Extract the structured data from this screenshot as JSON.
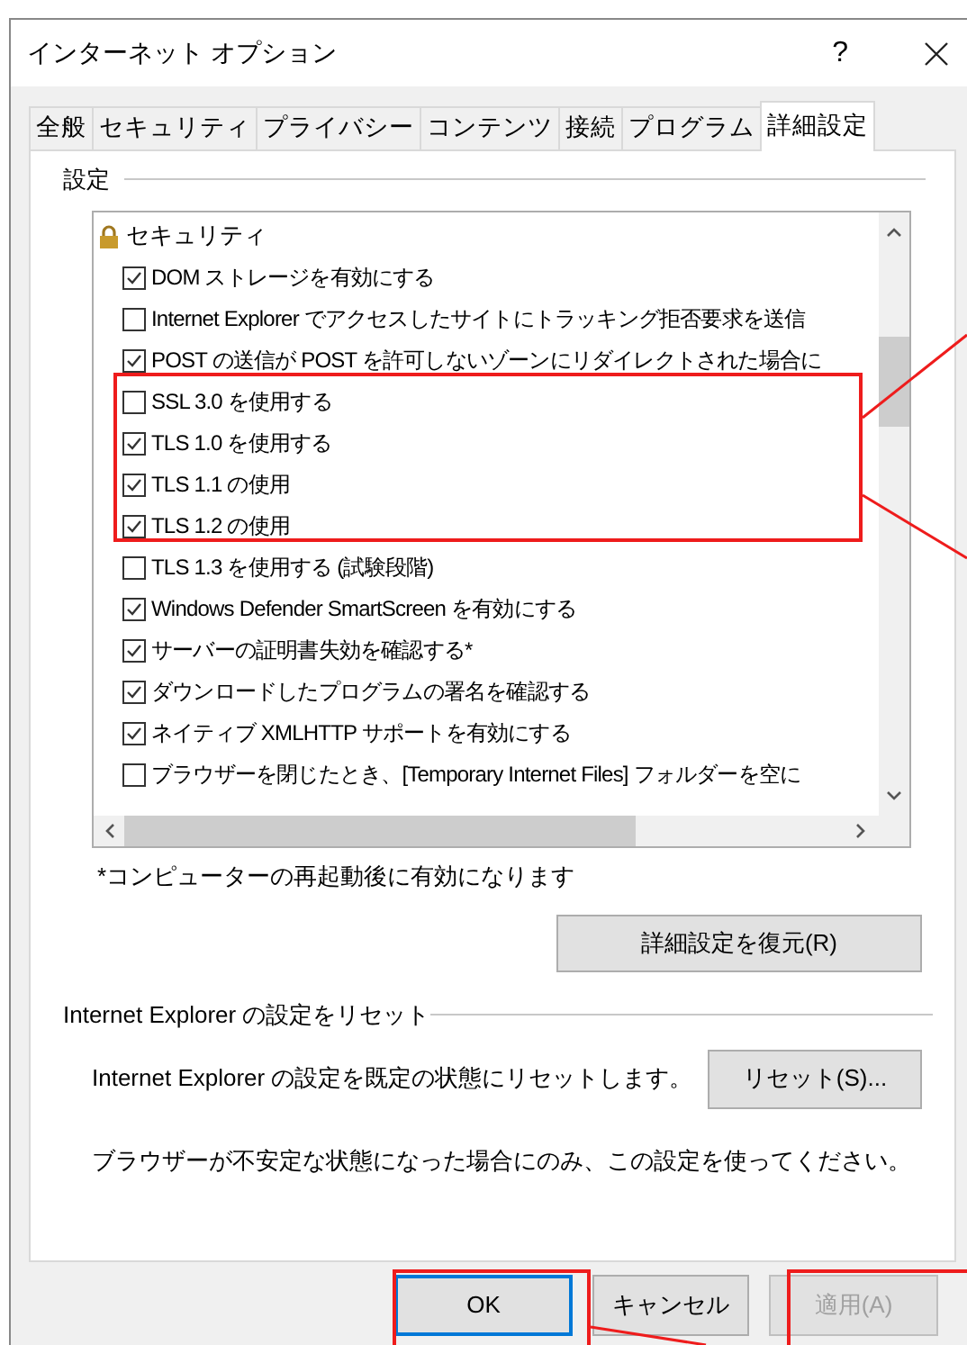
{
  "window": {
    "title": "インターネット オプション",
    "help": "?"
  },
  "tabs": [
    {
      "label": "全般",
      "selected": false
    },
    {
      "label": "セキュリティ",
      "selected": false
    },
    {
      "label": "プライバシー",
      "selected": false
    },
    {
      "label": "コンテンツ",
      "selected": false
    },
    {
      "label": "接続",
      "selected": false
    },
    {
      "label": "プログラム",
      "selected": false
    },
    {
      "label": "詳細設定",
      "selected": true
    }
  ],
  "settings": {
    "title": "設定",
    "categories": [
      {
        "label": "セキュリティ",
        "children": [
          {
            "label": "DOM ストレージを有効にする",
            "checked": true
          },
          {
            "label": "Internet Explorer でアクセスしたサイトにトラッキング拒否要求を送信",
            "checked": false
          },
          {
            "label": "POST の送信が POST を許可しないゾーンにリダイレクトされた場合に",
            "checked": true
          },
          {
            "label": "SSL 3.0 を使用する",
            "checked": false
          },
          {
            "label": "TLS 1.0 を使用する",
            "checked": true
          },
          {
            "label": "TLS 1.1 の使用",
            "checked": true
          },
          {
            "label": "TLS 1.2 の使用",
            "checked": true
          },
          {
            "label": "TLS 1.3 を使用する (試験段階)",
            "checked": false
          },
          {
            "label": "Windows Defender SmartScreen を有効にする",
            "checked": true
          },
          {
            "label": "サーバーの証明書失効を確認する*",
            "checked": true
          },
          {
            "label": "ダウンロードしたプログラムの署名を確認する",
            "checked": true
          },
          {
            "label": "ネイティブ XMLHTTP サポートを有効にする",
            "checked": true
          },
          {
            "label": "ブラウザーを閉じたとき、[Temporary Internet Files] フォルダーを空に",
            "checked": false
          }
        ]
      }
    ],
    "note": "*コンピューターの再起動後に有効になります",
    "restore_button": "詳細設定を復元(R)"
  },
  "reset": {
    "title": "Internet Explorer の設定をリセット",
    "description": "Internet Explorer の設定を既定の状態にリセットします。",
    "button": "リセット(S)...",
    "warning": "ブラウザーが不安定な状態になった場合にのみ、この設定を使ってください。"
  },
  "buttons": [
    {
      "label": "OK",
      "kind": "default",
      "disabled": false
    },
    {
      "label": "キャンセル",
      "kind": "normal",
      "disabled": false
    },
    {
      "label": "適用(A)",
      "kind": "normal",
      "disabled": true
    }
  ]
}
